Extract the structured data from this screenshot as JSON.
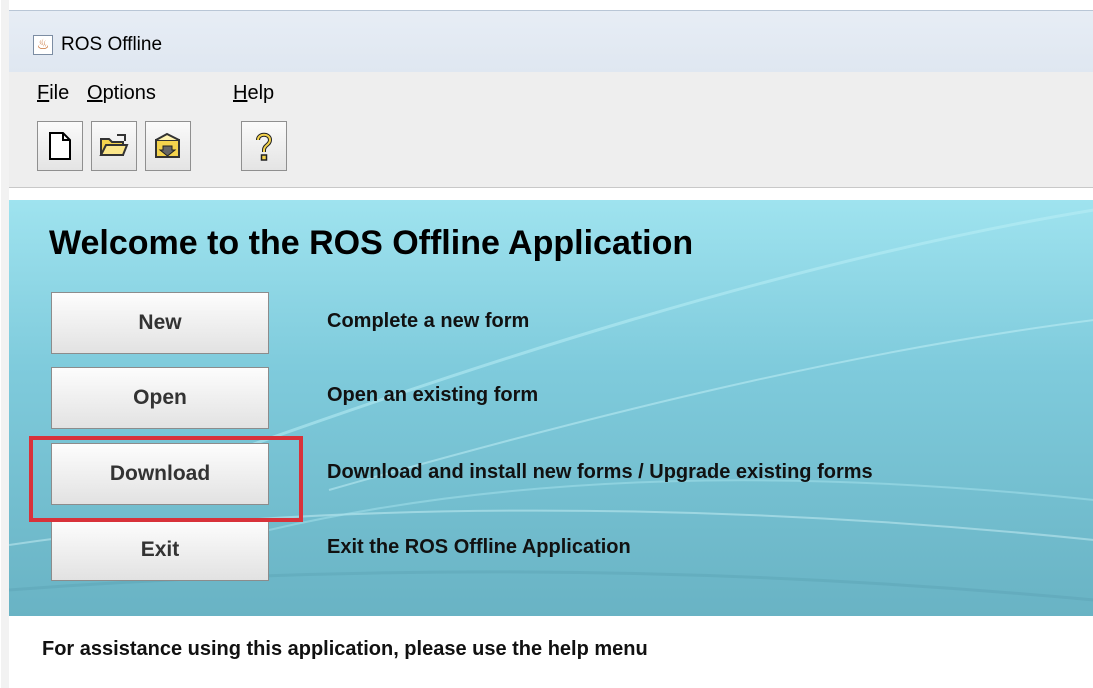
{
  "window": {
    "title": "ROS Offline",
    "icon": "java-coffee-icon"
  },
  "menu": {
    "items": [
      {
        "mnemonic": "F",
        "rest": "ile"
      },
      {
        "mnemonic": "O",
        "rest": "ptions"
      },
      {
        "mnemonic": "H",
        "rest": "elp"
      }
    ]
  },
  "toolbar": {
    "buttons": [
      {
        "icon": "new-document-icon",
        "glyph": "🗋"
      },
      {
        "icon": "open-folder-icon",
        "glyph": "📂"
      },
      {
        "icon": "download-form-icon",
        "glyph": "📥"
      },
      {
        "icon": "help-icon",
        "glyph": "?"
      }
    ]
  },
  "panel": {
    "heading": "Welcome to the ROS Offline Application",
    "actions": [
      {
        "label": "New",
        "description": "Complete a new form"
      },
      {
        "label": "Open",
        "description": "Open an existing form"
      },
      {
        "label": "Download",
        "description": "Download and install new forms / Upgrade existing forms"
      },
      {
        "label": "Exit",
        "description": "Exit the ROS Offline Application"
      }
    ]
  },
  "status": {
    "text": "For assistance using this application, please use the help menu"
  },
  "colors": {
    "panel_top": "#9fe3ef",
    "panel_bottom": "#69b3c4",
    "highlight": "#d8323a"
  }
}
